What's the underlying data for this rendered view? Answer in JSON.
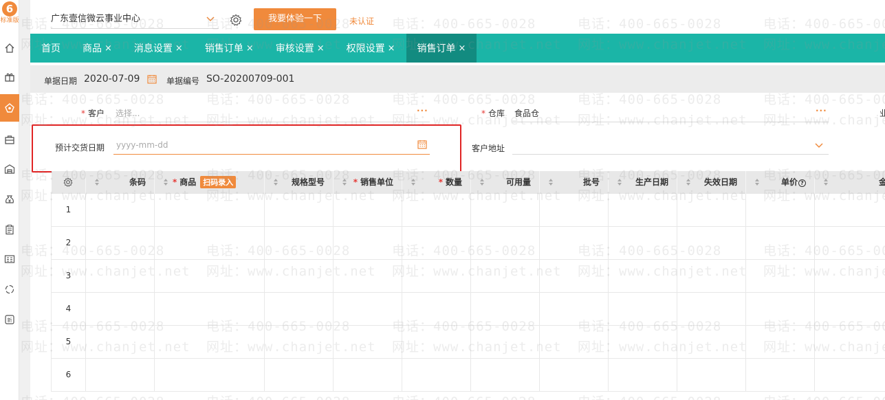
{
  "logo": {
    "number": "6",
    "text": "标准版"
  },
  "topbar": {
    "company": "广东壹信微云事业中心",
    "try_button": "我要体验一下",
    "status": "未认证"
  },
  "sidebar": {
    "items": [
      {
        "icon": "home-icon"
      },
      {
        "icon": "gift-icon"
      },
      {
        "icon": "tag-icon",
        "active": true
      },
      {
        "icon": "bag-icon"
      },
      {
        "icon": "warehouse-icon"
      },
      {
        "icon": "money-bag-icon"
      },
      {
        "icon": "clipboard-icon"
      },
      {
        "icon": "id-card-icon"
      },
      {
        "icon": "cycle-icon"
      },
      {
        "icon": "new-icon"
      }
    ]
  },
  "tabs": [
    {
      "label": "首页",
      "closable": false
    },
    {
      "label": "商品",
      "closable": true
    },
    {
      "label": "消息设置",
      "closable": true
    },
    {
      "label": "销售订单",
      "closable": true
    },
    {
      "label": "审核设置",
      "closable": true
    },
    {
      "label": "权限设置",
      "closable": true
    },
    {
      "label": "销售订单",
      "closable": true,
      "active": true
    }
  ],
  "tab_close": "×",
  "header": {
    "date_label": "单据日期",
    "date_value": "2020-07-09",
    "number_label": "单据编号",
    "number_value": "SO-20200709-001"
  },
  "form": {
    "customer_label": "客户",
    "customer_placeholder": "选择...",
    "warehouse_label": "仓库",
    "warehouse_value": "食品仓",
    "delivery_label": "预计交货日期",
    "delivery_placeholder": "yyyy-mm-dd",
    "address_label": "客户地址",
    "more": "···",
    "right_edge": "业"
  },
  "table": {
    "columns": [
      {
        "label": "条码",
        "required": false
      },
      {
        "label": "商品",
        "required": true,
        "badge": "扫码录入"
      },
      {
        "label": "规格型号",
        "required": false
      },
      {
        "label": "销售单位",
        "required": true
      },
      {
        "label": "数量",
        "required": true
      },
      {
        "label": "可用量",
        "required": false
      },
      {
        "label": "批号",
        "required": false
      },
      {
        "label": "生产日期",
        "required": false
      },
      {
        "label": "失效日期",
        "required": false
      },
      {
        "label": "单价",
        "required": false,
        "help": true
      },
      {
        "label": "金额",
        "required": false
      }
    ],
    "rows": [
      "1",
      "2",
      "3",
      "4",
      "5",
      "6"
    ]
  },
  "watermark": {
    "phone": "电话：400-665-0028",
    "site": "网址：www.chanjet.net"
  },
  "colors": {
    "teal": "#1bb5a7",
    "teal_dark": "#128b80",
    "orange": "#f08a3c",
    "red_box": "#e02424"
  }
}
